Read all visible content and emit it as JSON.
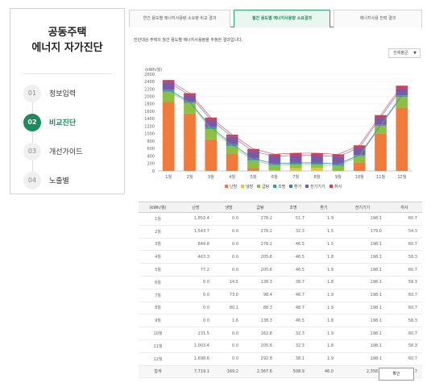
{
  "sidebar": {
    "title_line1": "공동주택",
    "title_line2": "에너지 자가진단",
    "steps": [
      {
        "num": "01",
        "label": "정보입력"
      },
      {
        "num": "02",
        "label": "비교진단"
      },
      {
        "num": "03",
        "label": "개선가이드"
      },
      {
        "num": "04",
        "label": "노출별"
      }
    ]
  },
  "tabs": [
    {
      "label": "연간 용도별 에너지사용량 소요량 비교 결과"
    },
    {
      "label": "월간 용도별 에너지사용량 소요결과"
    },
    {
      "label": "에너지사용 전력 결과"
    }
  ],
  "description": "진단대상 주택의 월간 용도별 에너지사용량을 추정한 결과입니다.",
  "select": {
    "value": "전체평균"
  },
  "chart_data": {
    "type": "bar",
    "stacked": true,
    "ylabel": "(kWh/월)",
    "ylim": [
      0,
      2600
    ],
    "yticks": [
      0,
      200,
      400,
      600,
      800,
      1000,
      1200,
      1400,
      1600,
      1800,
      2000,
      2200,
      2400,
      2600
    ],
    "categories": [
      "1월",
      "2월",
      "3월",
      "4월",
      "5월",
      "6월",
      "7월",
      "8월",
      "9월",
      "10월",
      "11월",
      "12월"
    ],
    "series": [
      {
        "name": "난방",
        "color": "#f07b3a",
        "values": [
          1852.4,
          1543.7,
          849.8,
          463.3,
          77.2,
          0.0,
          0.0,
          0.0,
          0.0,
          231.5,
          1003.4,
          1698.6
        ]
      },
      {
        "name": "냉방",
        "color": "#f2c12e",
        "values": [
          0.0,
          0.0,
          0.0,
          0.0,
          0.0,
          14.5,
          73.0,
          80.1,
          1.6,
          0.0,
          0.0,
          0.0
        ]
      },
      {
        "name": "급탕",
        "color": "#8dbf45",
        "values": [
          278.2,
          278.2,
          278.2,
          205.6,
          205.6,
          138.3,
          98.4,
          88.3,
          138.3,
          162.8,
          205.6,
          292.8
        ]
      },
      {
        "name": "조명",
        "color": "#2e9fae",
        "values": [
          51.7,
          32.3,
          46.5,
          46.5,
          46.5,
          38.7,
          46.7,
          48.7,
          46.5,
          32.3,
          32.3,
          38.1
        ]
      },
      {
        "name": "환기",
        "color": "#3e7bbd",
        "values": [
          1.9,
          1.5,
          1.5,
          1.8,
          1.9,
          1.8,
          1.9,
          1.9,
          1.8,
          1.9,
          1.8,
          1.9
        ]
      },
      {
        "name": "전기기기",
        "color": "#7a5aa6",
        "values": [
          198.1,
          179.0,
          198.1,
          198.1,
          198.1,
          198.1,
          198.1,
          198.1,
          198.1,
          198.1,
          198.1,
          198.1
        ]
      },
      {
        "name": "취사",
        "color": "#d83b55",
        "values": [
          60.7,
          54.3,
          60.7,
          58.3,
          60.7,
          58.3,
          60.7,
          60.7,
          58.3,
          60.7,
          58.3,
          60.7
        ]
      }
    ]
  },
  "table": {
    "headers": [
      "(kWh/월)",
      "난방",
      "냉방",
      "급탕",
      "조명",
      "환기",
      "전기기기",
      "취사"
    ],
    "rows": [
      [
        "1월",
        "1,852.4",
        "0.0",
        "278.2",
        "51.7",
        "1.9",
        "198.1",
        "60.7"
      ],
      [
        "2월",
        "1,543.7",
        "0.0",
        "278.2",
        "32.3",
        "1.5",
        "179.0",
        "54.3"
      ],
      [
        "3월",
        "849.8",
        "0.0",
        "278.2",
        "46.5",
        "1.5",
        "198.1",
        "60.7"
      ],
      [
        "4월",
        "463.3",
        "0.0",
        "205.6",
        "46.5",
        "1.8",
        "198.1",
        "58.3"
      ],
      [
        "5월",
        "77.2",
        "0.0",
        "205.6",
        "46.5",
        "1.9",
        "198.1",
        "60.7"
      ],
      [
        "6월",
        "0.0",
        "14.5",
        "138.3",
        "38.7",
        "1.8",
        "198.1",
        "58.3"
      ],
      [
        "7월",
        "0.0",
        "73.0",
        "98.4",
        "46.7",
        "1.9",
        "198.1",
        "60.7"
      ],
      [
        "8월",
        "0.0",
        "80.1",
        "88.3",
        "48.7",
        "1.9",
        "198.1",
        "60.7"
      ],
      [
        "9월",
        "0.0",
        "1.6",
        "138.3",
        "46.5",
        "1.8",
        "198.1",
        "58.3"
      ],
      [
        "10월",
        "231.5",
        "0.0",
        "162.8",
        "32.3",
        "1.9",
        "198.1",
        "60.7"
      ],
      [
        "11월",
        "1,003.4",
        "0.0",
        "205.6",
        "32.3",
        "1.8",
        "198.1",
        "58.3"
      ],
      [
        "12월",
        "1,698.6",
        "0.0",
        "292.8",
        "38.1",
        "1.9",
        "198.1",
        "60.7"
      ]
    ],
    "total": [
      "합계",
      "7,719.1",
      "169.2",
      "2,367.6",
      "508.9",
      "46.0",
      "2,358.8",
      "714.7"
    ]
  },
  "print_label": "확인"
}
